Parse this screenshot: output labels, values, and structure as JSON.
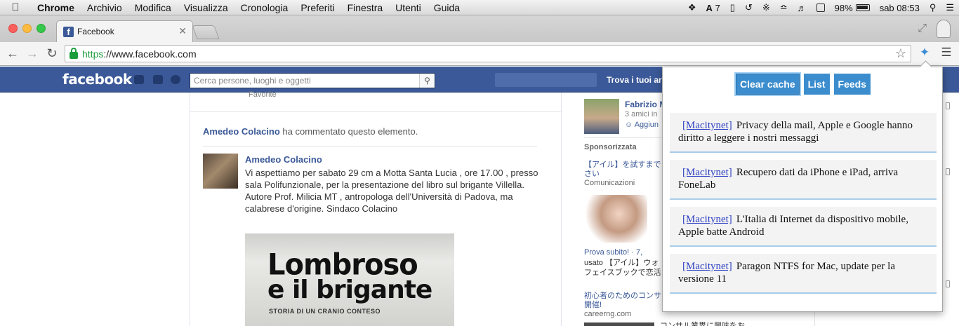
{
  "menubar": {
    "app": "Chrome",
    "items": [
      "Archivio",
      "Modifica",
      "Visualizza",
      "Cronologia",
      "Preferiti",
      "Finestra",
      "Utenti",
      "Guida"
    ],
    "status_num": "7",
    "battery": "98%",
    "clock": "sab 08:53"
  },
  "browser": {
    "tab_title": "Facebook",
    "url_scheme": "https",
    "url_rest": "://www.facebook.com"
  },
  "facebook": {
    "logo": "facebook",
    "search_placeholder": "Cerca persone, luoghi e oggetti",
    "find_friends": "Trova i tuoi ar",
    "favorite_label": "Favorite",
    "activity": {
      "actor": "Amedeo Colacino",
      "text": " ha commentato questo elemento."
    },
    "post": {
      "author": "Amedeo Colacino",
      "text": "Vi aspettiamo per sabato 29 cm a Motta Santa Lucia , ore 17.00 , presso sala Polifunzionale, per la presentazione del libro sul brigante Villella. Autore Prof. Milicia MT , antropologa dell'Università di Padova, ma calabrese d'origine. Sindaco Colacino",
      "book_title_1": "Lombroso",
      "book_title_2": "e il brigante",
      "book_subtitle": "STORIA DI UN CRANIO CONTESO"
    },
    "right": {
      "suggestion_name": "Fabrizio M",
      "suggestion_mutual": "3 amici in",
      "suggestion_add": "Aggiun",
      "sponsored": "Sponsorizzata",
      "ad1_title": "【アイル】を試すまで さい",
      "ad1_site": "Comunicazioni",
      "ad2_like": "Prova subito! · 7,",
      "ad2_text": "usato 【アイル】ウォ フェイスブックで恋活",
      "ad3_title": "初心者のためのコンサ 開催!",
      "ad3_site": "careerng.com",
      "ad4_text": "コンサル業界に興味をお"
    }
  },
  "popup": {
    "buttons": [
      "Clear cache",
      "List",
      "Feeds"
    ],
    "items": [
      {
        "source": "[Macitynet]",
        "title": "Privacy della mail, Apple e Google hanno diritto a leggere i nostri messaggi"
      },
      {
        "source": "[Macitynet]",
        "title": "Recupero dati da iPhone e iPad, arriva FoneLab"
      },
      {
        "source": "[Macitynet]",
        "title": "L'Italia di Internet da dispositivo mobile, Apple batte Android"
      },
      {
        "source": "[Macitynet]",
        "title": "Paragon NTFS for Mac, update per la versione 11"
      }
    ]
  },
  "colors": {
    "facebook_blue": "#3b5998",
    "popup_button": "#3c8dce",
    "https_green": "#1c9d3c"
  }
}
